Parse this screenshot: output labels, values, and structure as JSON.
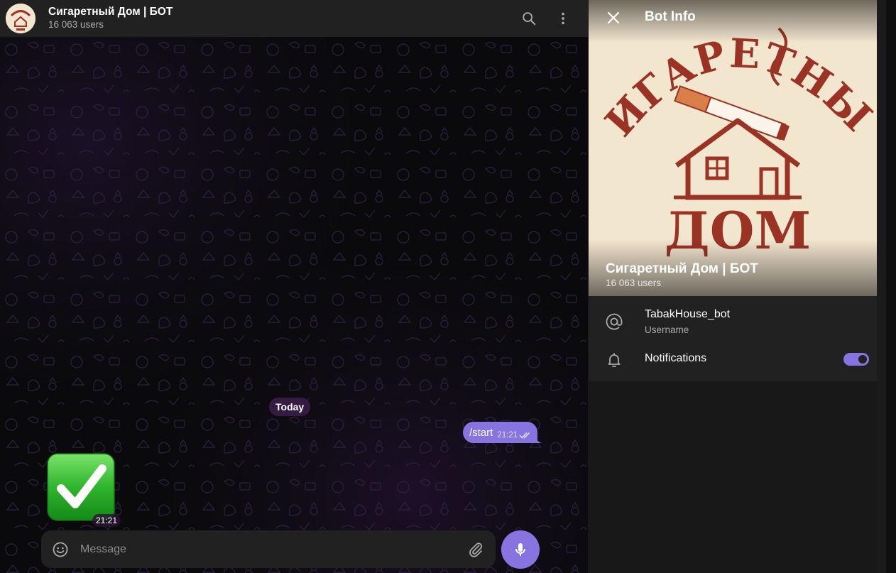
{
  "header": {
    "title": "Сигаретный Дом | БОТ",
    "subtitle": "16 063 users",
    "avatar_text": "Сигаретный дом"
  },
  "chat": {
    "date_label": "Today",
    "messages": [
      {
        "direction": "out",
        "text": "/start",
        "time": "21:21",
        "status": "read"
      },
      {
        "direction": "in",
        "type": "sticker",
        "emoji": "check-mark",
        "time": "21:21"
      }
    ]
  },
  "composer": {
    "placeholder": "Message"
  },
  "info_panel": {
    "title": "Bot Info",
    "logo_top_text": "СИГАРЕТНЫЙ",
    "logo_bottom_text": "ДОМ",
    "name": "Сигаретный Дом | БОТ",
    "subtitle": "16 063 users",
    "username_value": "TabakHouse_bot",
    "username_label": "Username",
    "notifications_label": "Notifications",
    "notifications_enabled": true
  },
  "colors": {
    "accent": "#8774e1",
    "panel": "#212121",
    "logo_brown": "#9b3325",
    "logo_bg": "#f3e6cf",
    "sticker_green": "#2fb52d"
  },
  "icons": [
    "search-icon",
    "more-vertical-icon",
    "close-icon",
    "at-icon",
    "bell-icon",
    "smile-icon",
    "paperclip-icon",
    "microphone-icon",
    "double-check-icon"
  ]
}
